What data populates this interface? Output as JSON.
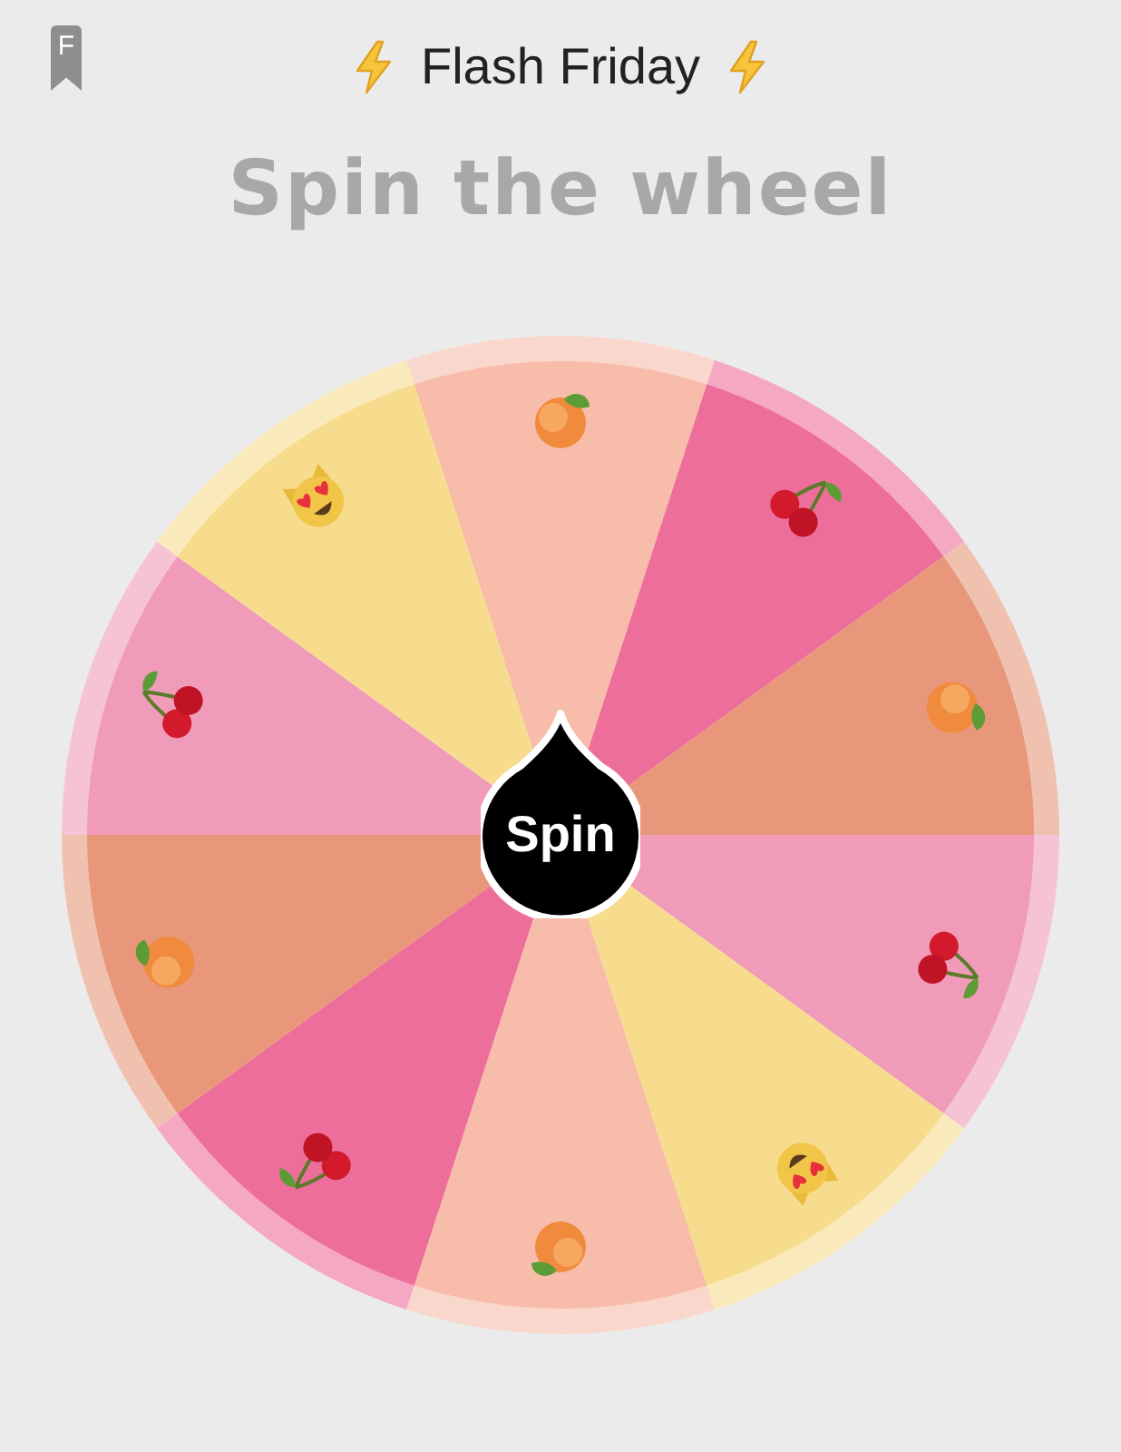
{
  "header": {
    "badge": "F",
    "title": "Flash Friday"
  },
  "heading": "Spin the wheel",
  "wheel": {
    "button": "Spin",
    "segments": [
      {
        "kind": "peach",
        "color": "#f7bcaa"
      },
      {
        "kind": "cherry",
        "color": "#ee6e9b"
      },
      {
        "kind": "peach",
        "color": "#e8977a"
      },
      {
        "kind": "cherry",
        "color": "#f09bb9"
      },
      {
        "kind": "cat",
        "color": "#f7dc8d"
      },
      {
        "kind": "peach",
        "color": "#f7bcaa"
      },
      {
        "kind": "cherry",
        "color": "#ee6e9b"
      },
      {
        "kind": "peach",
        "color": "#e8977a"
      },
      {
        "kind": "cherry",
        "color": "#f09bb9"
      },
      {
        "kind": "cat",
        "color": "#f7dc8d"
      }
    ]
  }
}
